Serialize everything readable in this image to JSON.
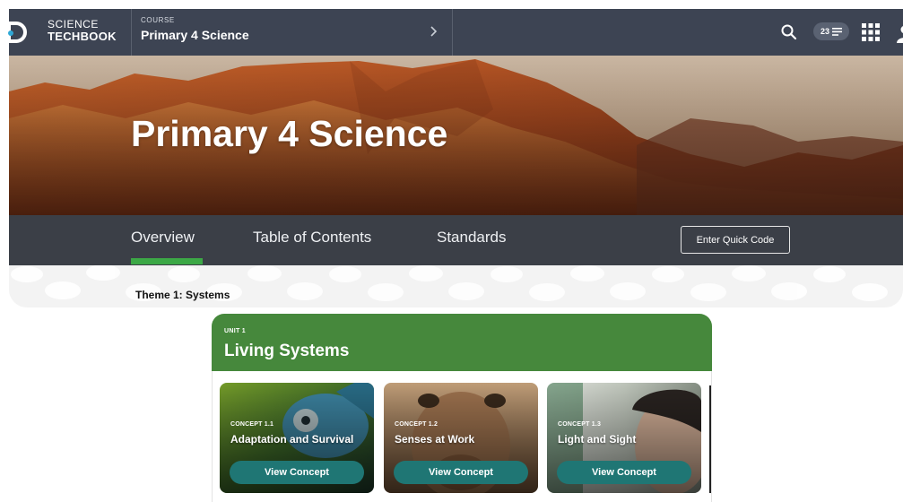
{
  "header": {
    "brand_line1": "SCIENCE",
    "brand_line2": "TECHBOOK",
    "course_label": "COURSE",
    "course_name": "Primary 4 Science",
    "notification_count": "23",
    "icons": [
      "logo-icon",
      "chevron-right-icon",
      "search-icon",
      "notification-icon",
      "apps-grid-icon",
      "user-icon"
    ]
  },
  "hero": {
    "title": "Primary 4 Science"
  },
  "tabs": {
    "items": [
      {
        "label": "Overview",
        "active": true
      },
      {
        "label": "Table of Contents",
        "active": false
      },
      {
        "label": "Standards",
        "active": false
      }
    ],
    "quick_code_label": "Enter Quick Code"
  },
  "theme": {
    "title": "Theme 1: Systems"
  },
  "unit": {
    "label": "UNIT 1",
    "title": "Living Systems",
    "concepts": [
      {
        "label": "CONCEPT 1.1",
        "title": "Adaptation and Survival",
        "button": "View Concept"
      },
      {
        "label": "CONCEPT 1.2",
        "title": "Senses at Work",
        "button": "View Concept"
      },
      {
        "label": "CONCEPT 1.3",
        "title": "Light and Sight",
        "button": "View Concept"
      }
    ]
  },
  "colors": {
    "header_bg": "#3d4453",
    "tabs_bg": "#3b3f47",
    "active_tab_underline": "#3ca846",
    "unit_header": "#46883c",
    "concept_button": "#1f7674"
  }
}
